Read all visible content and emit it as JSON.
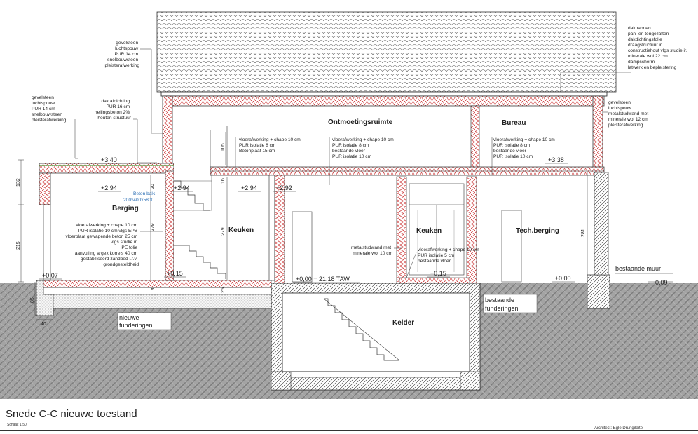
{
  "title": "Snede C-C nieuwe toestand",
  "scale": "Schaal: 1:50",
  "architect": "Architect: Eglė Drungilaitė",
  "colors": {
    "insulation": "#d04848",
    "ground": "#9a9a9a",
    "line": "#222222",
    "blue_text": "#2c6fb5"
  },
  "rooms": {
    "ontmoeting": "Ontmoetingsruimte",
    "bureau": "Bureau",
    "berging": "Berging",
    "keuken_left": "Keuken",
    "keuken_right": "Keuken",
    "tech": "Tech.berging",
    "kelder": "Kelder"
  },
  "notes": {
    "roof_left": [
      "gevelsteen",
      "luchtspouw",
      "PUR 14 cm",
      "snelbouwsteen",
      "pleisterafwerking"
    ],
    "left_wall": [
      "gevelsteen",
      "luchtspouw",
      "PUR 14 cm",
      "snelbouwsteen",
      "pleisterafwerking"
    ],
    "flat_roof": [
      "dak afdichting",
      "PUR 16 cm",
      "hellingsbeton 2%",
      "houten structuur"
    ],
    "roof_right": [
      "dakpannen",
      "pan- en tengellatten",
      "dakdichtingsfolie",
      "draagstructuur in",
      "constructiehout vlgs studie ir.",
      "minerale wol 22 cm",
      "dampscherm",
      "latwerk en bepleistering"
    ],
    "right_wall": [
      "gevelsteen",
      "luchtspouw",
      "metalstudwand met",
      "minerale wol 12 cm",
      "pleisterafwerking"
    ],
    "floor_1": [
      "vloerafwerking + chape 10 cm",
      "PUR isolatie 8 cm",
      "Betonplaat 15 cm"
    ],
    "floor_2": [
      "vloerafwerking + chape 10 cm",
      "PUR isolatie 8 cm",
      "bestaande vloer",
      "PUR isolatie 10 cm"
    ],
    "floor_3": [
      "vloerafwerking + chape 10 cm",
      "PUR isolatie 8 cm",
      "bestaande vloer",
      "PUR isolatie 10 cm"
    ],
    "ground_floor": [
      "vloerafwerking + chape 10 cm",
      "PUR isolatie 10 cm vlgs EPB",
      "vloerplaat gewapende beton 25 cm",
      "vlgs studie ir.",
      "PE folie",
      "aanvulling argex korrels 40 cm",
      "gestabiliseerd zandbed i.f.v.",
      "grondgesteldheid"
    ],
    "metalstud": [
      "metalstudwand met",
      "minerale wol 10 cm"
    ],
    "keuken_floor": [
      "vloerafwerking + chape 10 cm",
      "PUR isolatie 5 cm",
      "bestaande vloer"
    ],
    "beam": [
      "Beton balk",
      "200x400x5800"
    ],
    "new_found": [
      "nieuwe",
      "funderingen"
    ],
    "old_found": [
      "bestaande",
      "funderingen"
    ],
    "existing_wall": "bestaande muur"
  },
  "levels": {
    "l340": "+3,40",
    "l294a": "+2,94",
    "l294b": "+2,94",
    "l294c": "+2,94",
    "l292": "+2,92",
    "l338": "+3,38",
    "l007": "+0,07",
    "l015a": "+0,15",
    "l015b": "+0,15",
    "l000": "+0,00 = 21,18 TAW",
    "l000r": "±0,00",
    "l009": "-0,09"
  },
  "dims": {
    "d132": "132",
    "d215": "215",
    "d85": "85",
    "d40": "40",
    "d279a": "279",
    "d279b": "279",
    "d105": "105",
    "d281": "281",
    "d16": "16",
    "d20": "20",
    "d4": "4",
    "d25": "25"
  }
}
